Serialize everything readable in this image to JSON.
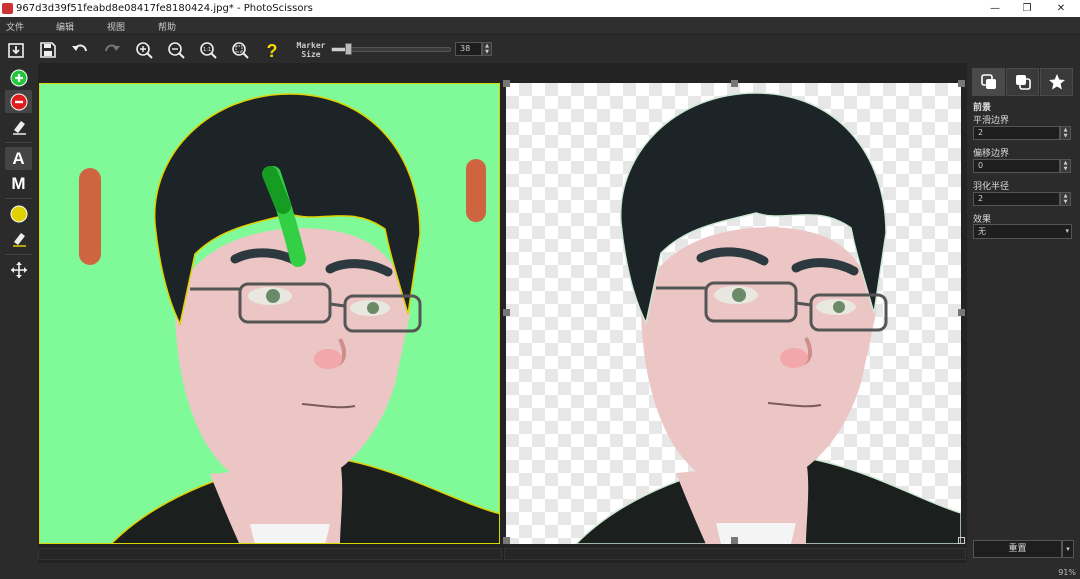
{
  "window": {
    "title": "967d3d39f51feabd8e08417fe8180424.jpg* - PhotoScissors",
    "controls": {
      "minimize": "—",
      "restore": "❐",
      "close": "✕"
    }
  },
  "menu": [
    "文件",
    "编辑",
    "视图",
    "帮助"
  ],
  "toolbar": {
    "marker_label": "Marker Size",
    "marker_value": "38",
    "marker_fraction": 0.12,
    "icons": [
      "import-icon",
      "save-icon",
      "undo-icon",
      "redo-icon",
      "zoom-in-icon",
      "zoom-out-icon",
      "zoom-actual-icon",
      "zoom-fit-icon",
      "help-icon"
    ]
  },
  "left_tools": {
    "auto_label": "A",
    "manual_label": "M",
    "colors": {
      "foreground_marker": "#22c83a",
      "background_marker": "#e01b1b",
      "edge_marker": "#e0d000"
    }
  },
  "right_panel": {
    "section_title": "前景",
    "smooth_label": "平滑边界",
    "smooth_value": "2",
    "offset_label": "偏移边界",
    "offset_value": "0",
    "feather_label": "羽化半径",
    "feather_value": "2",
    "effect_label": "效果",
    "effect_value": "无",
    "reset_label": "重置"
  },
  "status": {
    "zoom": "91%"
  },
  "colors": {
    "source_background": "#80fa98",
    "hair": "#1d2428",
    "skin": "#ecc6c4",
    "bg_stroke": "#cf6440",
    "fg_stroke": "#33d046"
  }
}
